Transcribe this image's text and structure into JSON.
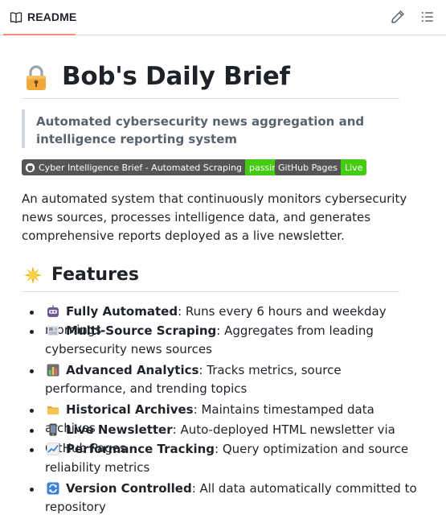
{
  "tabs": {
    "readme_label": "README"
  },
  "toolbar": {
    "edit_icon": "pencil-icon",
    "outline_icon": "list-icon"
  },
  "heading": {
    "emoji": "lock-emoji",
    "title": "Bob's Daily Brief"
  },
  "tagline": "Automated cybersecurity news aggregation and intelligence reporting system",
  "badges": [
    {
      "label": "Cyber Intelligence Brief - Automated Scraping",
      "status": "passing",
      "color": "#4c1"
    },
    {
      "label": "GitHub Pages",
      "status": "Live",
      "color": "#4c1"
    }
  ],
  "description": "An automated system that continuously monitors cybersecurity news sources, processes intelligence data, and generates comprehensive reports deployed as a live newsletter.",
  "features": {
    "emoji": "sparkle-emoji",
    "title": "Features",
    "items": [
      {
        "icon": "robot-emoji",
        "title": "Fully Automated",
        "text": ": Runs every 6 hours and weekday mornings"
      },
      {
        "icon": "newspaper-emoji",
        "title": "Multi-Source Scraping",
        "text": ": Aggregates from leading cybersecurity news sources"
      },
      {
        "icon": "bar-chart-emoji",
        "title": "Advanced Analytics",
        "text": ": Tracks metrics, source performance, and trending topics"
      },
      {
        "icon": "folder-emoji",
        "title": "Historical Archives",
        "text": ": Maintains timestamped data archives"
      },
      {
        "icon": "phone-emoji",
        "title": "Live Newsletter",
        "text": ": Auto-deployed HTML newsletter via GitHub Pages"
      },
      {
        "icon": "chart-up-emoji",
        "title": "Performance Tracking",
        "text": ": Query optimization and source reliability metrics"
      },
      {
        "icon": "cycle-arrows-emoji",
        "title": "Version Controlled",
        "text": ": All data automatically committed to repository"
      }
    ]
  },
  "colors": {
    "accent_tab": "#fd8c73",
    "badge_green": "#4c1",
    "badge_dark": "#555555"
  }
}
